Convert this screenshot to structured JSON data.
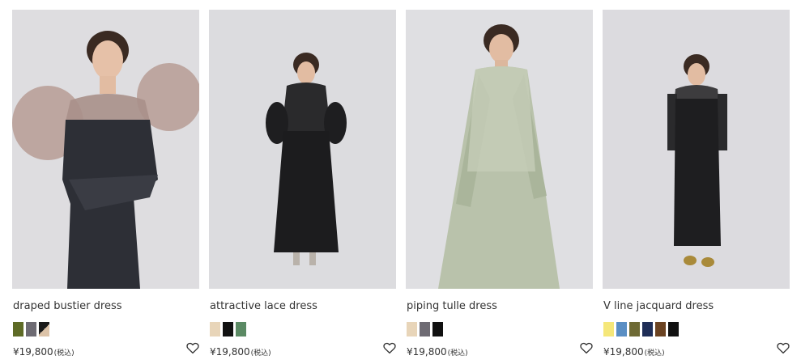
{
  "products": [
    {
      "name": "draped bustier dress",
      "price": "¥19,800",
      "tax": "(税込)",
      "favorite_icon": "heart-outline-icon",
      "swatches": [
        {
          "color": "#5e6b26"
        },
        {
          "color": "#6e6b73"
        },
        {
          "color": "#1a1a1a",
          "color2": "#dcc3a8"
        }
      ]
    },
    {
      "name": "attractive lace dress",
      "price": "¥19,800",
      "tax": "(税込)",
      "favorite_icon": "heart-outline-icon",
      "swatches": [
        {
          "color": "#e8d5b9"
        },
        {
          "color": "#111111"
        },
        {
          "color": "#5b8a64"
        }
      ]
    },
    {
      "name": "piping tulle dress",
      "price": "¥19,800",
      "tax": "(税込)",
      "favorite_icon": "heart-outline-icon",
      "swatches": [
        {
          "color": "#e8d5b9"
        },
        {
          "color": "#6e6b73"
        },
        {
          "color": "#111111"
        }
      ]
    },
    {
      "name": "V line jacquard dress",
      "price": "¥19,800",
      "tax": "(税込)",
      "favorite_icon": "heart-outline-icon",
      "swatches": [
        {
          "color": "#f5e77a"
        },
        {
          "color": "#5b8fc4"
        },
        {
          "color": "#6e6a35"
        },
        {
          "color": "#1f2e57"
        },
        {
          "color": "#6b4322"
        },
        {
          "color": "#111111"
        }
      ]
    }
  ]
}
